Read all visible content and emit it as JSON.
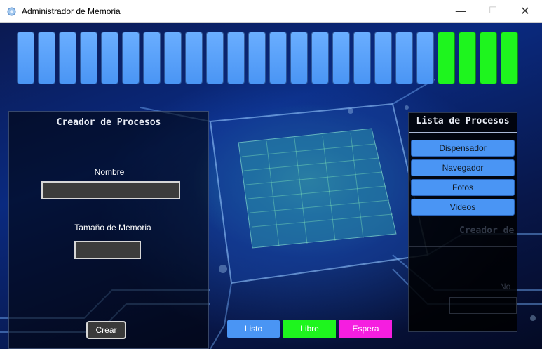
{
  "window": {
    "title": "Administrador de Memoria",
    "minimize_glyph": "—",
    "maximize_glyph": "☐",
    "close_glyph": "✕"
  },
  "memory": {
    "blocks": [
      "used",
      "used",
      "used",
      "used",
      "used",
      "used",
      "used",
      "used",
      "used",
      "used",
      "used",
      "used",
      "used",
      "used",
      "used",
      "used",
      "used",
      "used",
      "used",
      "used",
      "free",
      "free",
      "free",
      "free"
    ],
    "colors": {
      "used": "#4a95f4",
      "free": "#1ef51e",
      "wait": "#f51ee0"
    }
  },
  "creator": {
    "title": "Creador de Procesos",
    "name_label": "Nombre",
    "name_value": "",
    "size_label": "Tamaño de Memoria",
    "size_value": "",
    "create_button": "Crear"
  },
  "process_list": {
    "title": "Lista de Procesos",
    "items": [
      "Dispensador",
      "Navegador",
      "Fotos",
      "Videos"
    ],
    "ghost_title": "Creador de",
    "ghost_label": "No"
  },
  "legend": {
    "ready": "Listo",
    "free": "Libre",
    "waiting": "Espera"
  }
}
